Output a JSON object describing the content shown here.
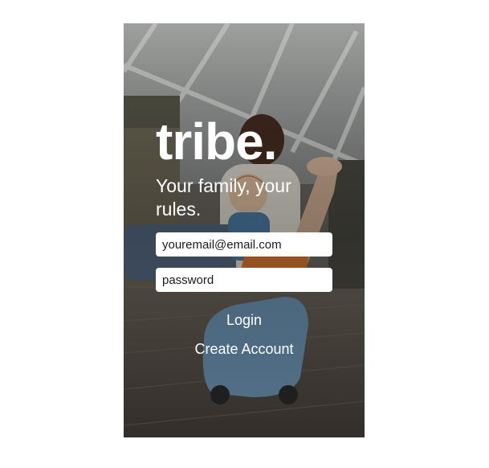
{
  "app": {
    "brand": "tribe.",
    "tagline": "Your family, your rules."
  },
  "login_form": {
    "email_placeholder": "youremail@email.com",
    "email_value": "",
    "password_placeholder": "password",
    "password_value": "",
    "login_label": "Login",
    "create_account_label": "Create Account"
  },
  "background": {
    "image": "photo of a parent and toddler riding a plastic ride-on toy inside a glass-roofed sunroom",
    "colors": {
      "glass_roof": "#c9ccc8",
      "floor": "#5d564f",
      "toy_blue": "#6f97b8",
      "toy_orange": "#e07a2e"
    }
  }
}
